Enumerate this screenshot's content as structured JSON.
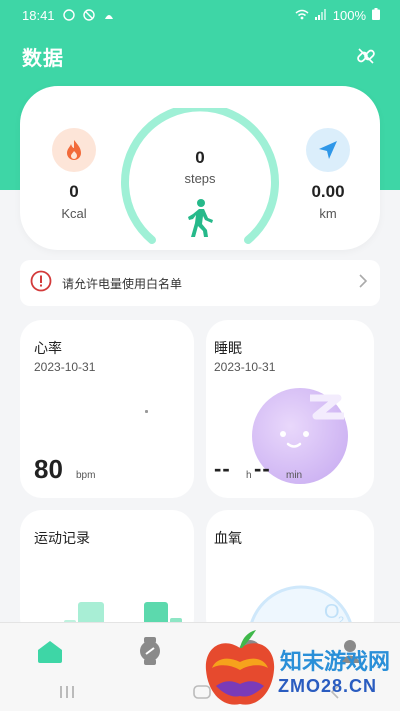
{
  "status_bar": {
    "time": "18:41",
    "battery": "100%"
  },
  "header": {
    "title": "数据",
    "link_icon": "link-icon"
  },
  "activity": {
    "kcal_value": "0",
    "kcal_unit": "Kcal",
    "steps_value": "0",
    "steps_unit": "steps",
    "distance_value": "0.00",
    "distance_unit": "km",
    "steps_progress": 0
  },
  "notice": {
    "text": "请允许电量使用白名单"
  },
  "tiles": {
    "heart_rate": {
      "title": "心率",
      "date": "2023-10-31",
      "value": "80",
      "unit": "bpm"
    },
    "sleep": {
      "title": "睡眠",
      "date": "2023-10-31",
      "hours": "--",
      "hours_unit": "h",
      "minutes": "--",
      "minutes_unit": "min"
    },
    "exercise": {
      "title": "运动记录"
    },
    "spo2": {
      "title": "血氧"
    }
  },
  "bottom_nav": {
    "items": [
      "home-icon",
      "watch-icon",
      "discover-icon",
      "profile-icon"
    ]
  },
  "watermark": {
    "line1": "知末游戏网",
    "line2": "ZMO28.CN"
  },
  "colors": {
    "accent": "#3ed6a6",
    "ring": "#9ff0d6",
    "kcal_icon": "#f26a3a",
    "km_icon": "#2f97e8",
    "warning": "#d33a3a"
  }
}
